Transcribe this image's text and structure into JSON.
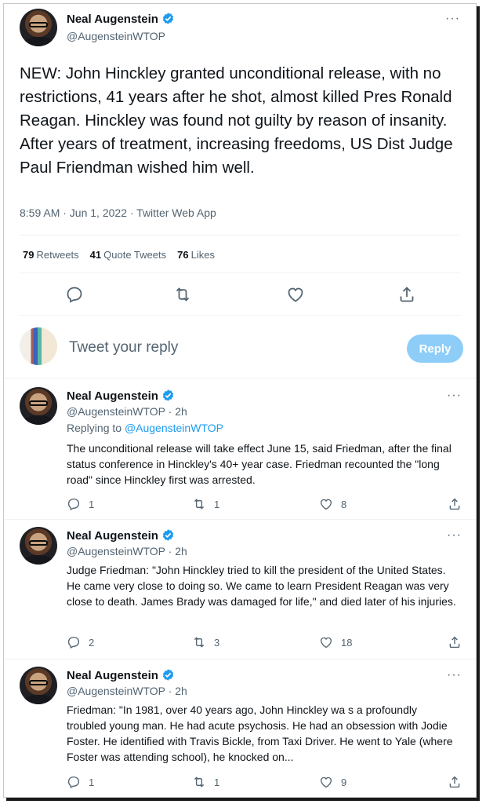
{
  "main_tweet": {
    "author_name": "Neal Augenstein",
    "author_handle": "@AugensteinWTOP",
    "more_label": "···",
    "text": "NEW: John Hinckley granted unconditional release, with no restrictions, 41 years after he shot, almost killed Pres Ronald Reagan. Hinckley was found not guilty by reason of insanity. After years of treatment, increasing freedoms, US Dist Judge Paul Friendman wished him well.",
    "meta": "8:59 AM · Jun 1, 2022 · Twitter Web App",
    "stats": [
      {
        "count": "79",
        "label": "Retweets"
      },
      {
        "count": "41",
        "label": "Quote Tweets"
      },
      {
        "count": "76",
        "label": "Likes"
      }
    ]
  },
  "reply_box": {
    "placeholder": "Tweet your reply",
    "button_label": "Reply"
  },
  "replies": [
    {
      "author_name": "Neal Augenstein",
      "author_handle": "@AugensteinWTOP · 2h",
      "replying_prefix": "Replying to ",
      "replying_to": "@AugensteinWTOP",
      "text": "The unconditional release will take effect June 15, said Friedman, after the final status conference in Hinckley's 40+ year case. Friedman recounted the \"long road\" since Hinckley first was arrested.",
      "reply_count": "1",
      "retweet_count": "1",
      "like_count": "8"
    },
    {
      "author_name": "Neal Augenstein",
      "author_handle": "@AugensteinWTOP · 2h",
      "text": "Judge Friedman: \"John Hinckley tried to kill the president of the United States. He came very close to doing so. We came to learn President Reagan was very close to death. James Brady was damaged for life,\" and died later of his injuries.",
      "reply_count": "2",
      "retweet_count": "3",
      "like_count": "18"
    },
    {
      "author_name": "Neal Augenstein",
      "author_handle": "@AugensteinWTOP · 2h",
      "text": "Friedman: \"In 1981, over 40 years ago, John Hinckley wa s a profoundly troubled young man. He had acute psychosis. He had an obsession with Jodie Foster. He identified with Travis Bickle, from Taxi Driver. He went to Yale (where Foster was attending school), he knocked on...",
      "reply_count": "1",
      "retweet_count": "1",
      "like_count": "9"
    }
  ],
  "colors": {
    "accent": "#1d9bf0",
    "muted": "#536471",
    "reply_button": "#8ecdf8"
  },
  "icons": [
    "verified-badge-icon",
    "reply-icon",
    "retweet-icon",
    "like-icon",
    "share-icon",
    "more-icon"
  ]
}
